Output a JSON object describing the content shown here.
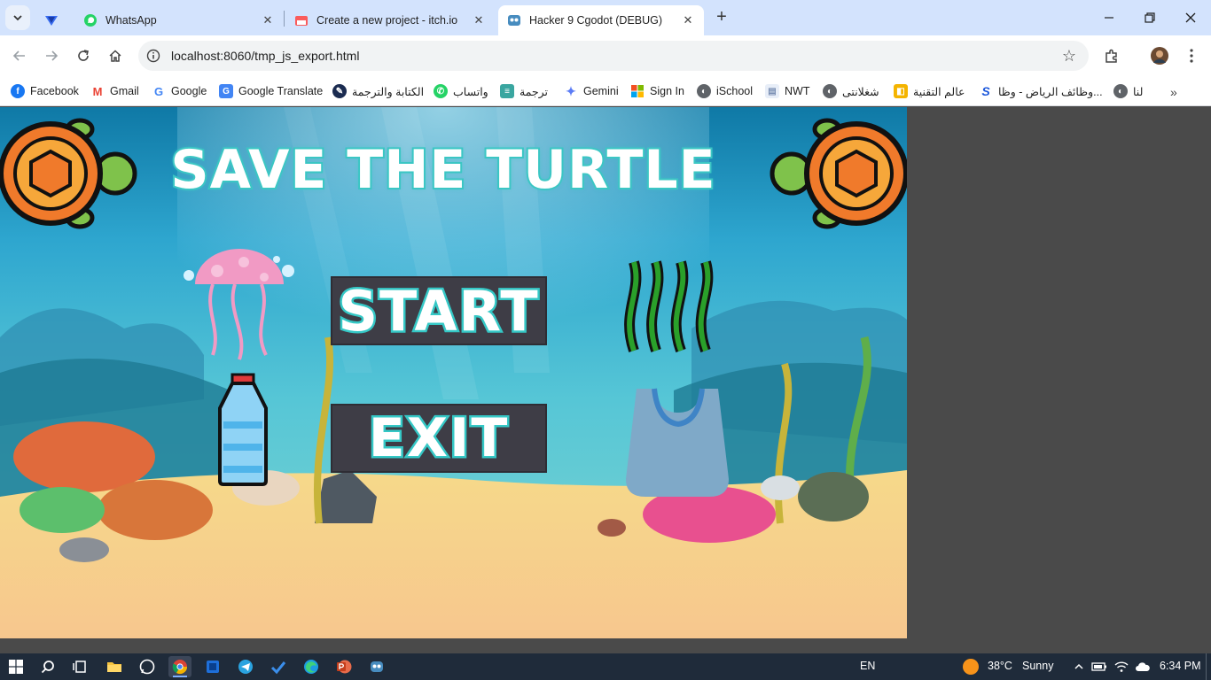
{
  "browser": {
    "tabs": [
      {
        "title": "",
        "icon": "proton-vpn-icon"
      },
      {
        "title": "WhatsApp",
        "icon": "whatsapp-icon"
      },
      {
        "title": "Create a new project - itch.io",
        "icon": "itchio-icon"
      },
      {
        "title": "Hacker 9 Cgodot (DEBUG)",
        "icon": "godot-icon",
        "active": true
      }
    ],
    "url": "localhost:8060/tmp_js_export.html"
  },
  "bookmarks": [
    {
      "label": "Facebook",
      "icon": "facebook-icon",
      "color": "#1877f2"
    },
    {
      "label": "Gmail",
      "icon": "gmail-icon",
      "color": "#ea4335"
    },
    {
      "label": "Google",
      "icon": "google-icon",
      "color": "#4285f4"
    },
    {
      "label": "Google Translate",
      "icon": "translate-icon",
      "color": "#4285f4"
    },
    {
      "label": "الكتابة والترجمة",
      "icon": "writing-icon",
      "color": "#1a2b50"
    },
    {
      "label": "واتساب",
      "icon": "whatsapp-icon",
      "color": "#25d366"
    },
    {
      "label": "ترجمة",
      "icon": "book-icon",
      "color": "#3aa6a0"
    },
    {
      "label": "Gemini",
      "icon": "gemini-icon",
      "color": "#5b7cf6"
    },
    {
      "label": "Sign In",
      "icon": "microsoft-icon",
      "color": "#f25022"
    },
    {
      "label": "iSchool",
      "icon": "globe-icon",
      "color": "#5f6368"
    },
    {
      "label": "NWT",
      "icon": "page-icon",
      "color": "#7a8fb3"
    },
    {
      "label": "شغلانتى",
      "icon": "globe-icon",
      "color": "#5f6368"
    },
    {
      "label": "عالم التقنية",
      "icon": "tech-icon",
      "color": "#f4b400"
    },
    {
      "label": "وظائف الرياض - وظا...",
      "icon": "s-icon",
      "color": "#1a56db"
    },
    {
      "label": "لنا",
      "icon": "globe-icon",
      "color": "#5f6368"
    }
  ],
  "game": {
    "title": "SAVE THE TURTLE",
    "start_label": "START",
    "exit_label": "EXIT"
  },
  "taskbar": {
    "language": "EN",
    "temperature": "38°C",
    "weather": "Sunny",
    "time": "6:34 PM"
  }
}
